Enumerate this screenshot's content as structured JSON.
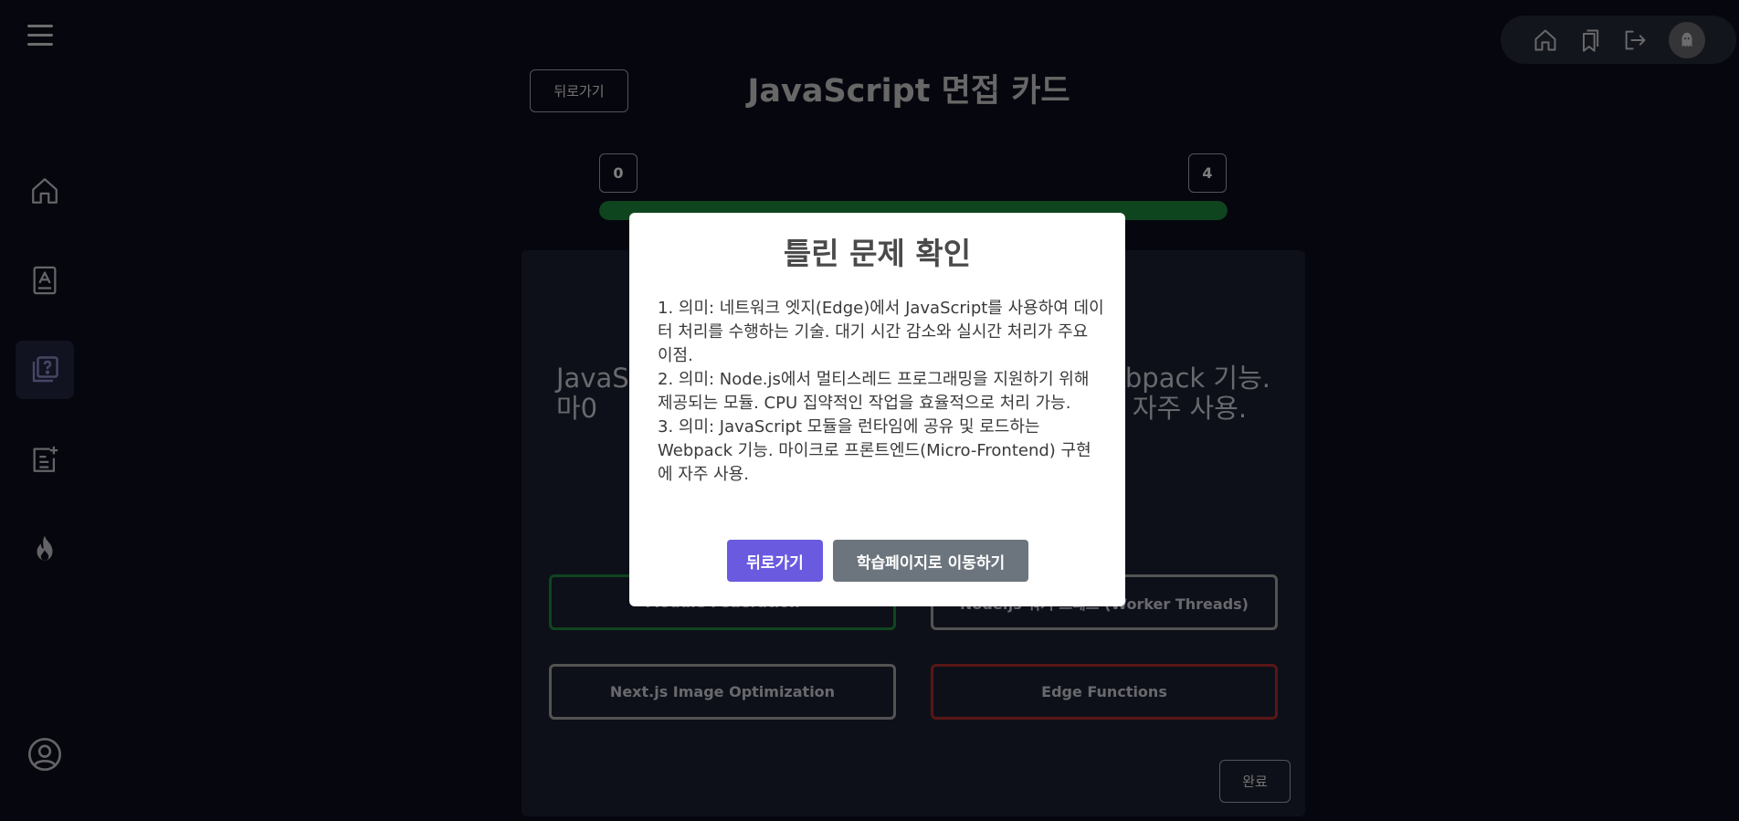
{
  "header": {
    "menu_icon": "hamburger-menu-icon",
    "back_label": "뒤로가기",
    "title": "JavaScript 면접 카드"
  },
  "sidebar": {
    "items": [
      {
        "icon": "home-icon",
        "active": false
      },
      {
        "icon": "study-book-icon",
        "active": false
      },
      {
        "icon": "quiz-cards-icon",
        "active": true
      },
      {
        "icon": "add-note-icon",
        "active": false
      },
      {
        "icon": "fire-icon",
        "active": false
      }
    ],
    "bottom_icon": "user-profile-icon"
  },
  "topbar": {
    "icons": [
      "home-icon",
      "bookmarks-icon",
      "logout-icon"
    ],
    "avatar_icon": "ghost-avatar-icon"
  },
  "progress": {
    "start_label": "0",
    "end_label": "4",
    "fraction": 1.0,
    "color": "#1e8a3c"
  },
  "quiz": {
    "question_left": "JavaSc\n마0",
    "question_right": "ebpack 기능.\n자주 사용.",
    "options": [
      {
        "label": "Module Federation",
        "state": "correct"
      },
      {
        "label": "Node.js 워커 스레드 (Worker Threads)",
        "state": "neutral"
      },
      {
        "label": "Next.js Image Optimization",
        "state": "neutral"
      },
      {
        "label": "Edge Functions",
        "state": "wrong"
      }
    ],
    "visible_labels": {
      "option3": "Next.js Image Optimization",
      "option4": "Edge Functions"
    },
    "done_label": "완료"
  },
  "modal": {
    "title": "틀린 문제 확인",
    "items": [
      "1. 의미: 네트워크 엣지(Edge)에서 JavaScript를 사용하여 데이터 처리를 수행하는 기술. 대기 시간 감소와 실시간 처리가 주요 이점.",
      "2. 의미: Node.js에서 멀티스레드 프로그래밍을 지원하기 위해 제공되는 모듈. CPU 집약적인 작업을 효율적으로 처리 가능.",
      "3. 의미: JavaScript 모듈을 런타임에 공유 및 로드하는 Webpack 기능. 마이크로 프론트엔드(Micro-Frontend) 구현에 자주 사용."
    ],
    "back_button": "뒤로가기",
    "study_button": "학습페이지로 이동하기"
  },
  "colors": {
    "background": "#0c0c1d",
    "card": "#1d2032",
    "accent_primary": "#6a5ae0",
    "correct": "#1f8b3d",
    "wrong": "#b52d2d"
  }
}
